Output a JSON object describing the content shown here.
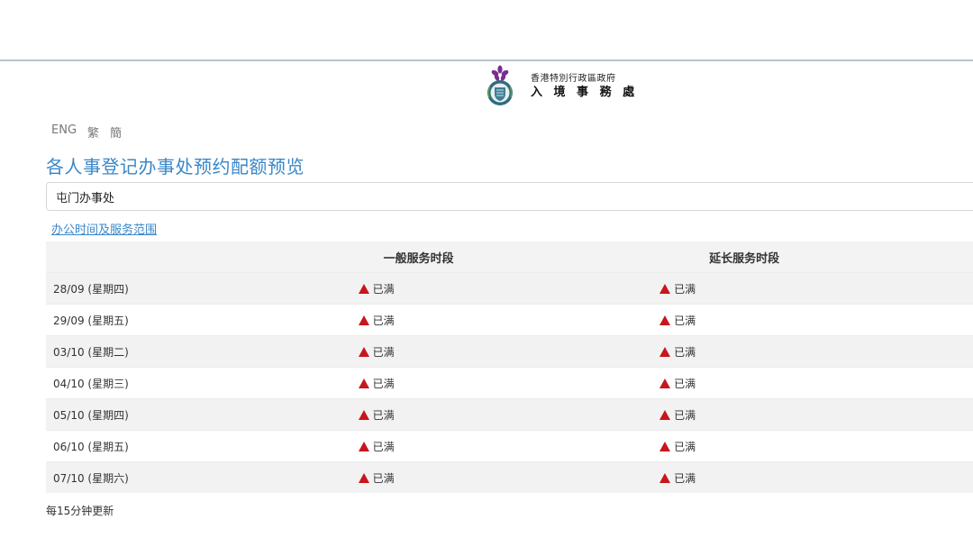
{
  "header": {
    "dept_sub": "香港特別行政區政府",
    "dept_main": "入 境 事 務 處"
  },
  "lang": [
    "ENG",
    "繁",
    "簡"
  ],
  "page_title": "各人事登记办事处预约配额预览",
  "office_select": {
    "value": "屯门办事处"
  },
  "hours_link": "办公时间及服务范围",
  "table": {
    "headers": [
      "",
      "一般服务时段",
      "延长服务时段"
    ],
    "rows": [
      {
        "date": "28/09 (星期四)",
        "general": "已满",
        "extended": "已满"
      },
      {
        "date": "29/09 (星期五)",
        "general": "已满",
        "extended": "已满"
      },
      {
        "date": "03/10 (星期二)",
        "general": "已满",
        "extended": "已满"
      },
      {
        "date": "04/10 (星期三)",
        "general": "已满",
        "extended": "已满"
      },
      {
        "date": "05/10 (星期四)",
        "general": "已满",
        "extended": "已满"
      },
      {
        "date": "06/10 (星期五)",
        "general": "已满",
        "extended": "已满"
      },
      {
        "date": "07/10 (星期六)",
        "general": "已满",
        "extended": "已满"
      }
    ]
  },
  "update_note": "每15分钟更新",
  "colors": {
    "accent": "#3a87c8",
    "full_status": "#c8161d",
    "emblem_purple": "#7b2d8e"
  },
  "icons": {
    "full_status": "red-warning-triangle-icon",
    "emblem": "immigration-department-emblem-icon"
  }
}
